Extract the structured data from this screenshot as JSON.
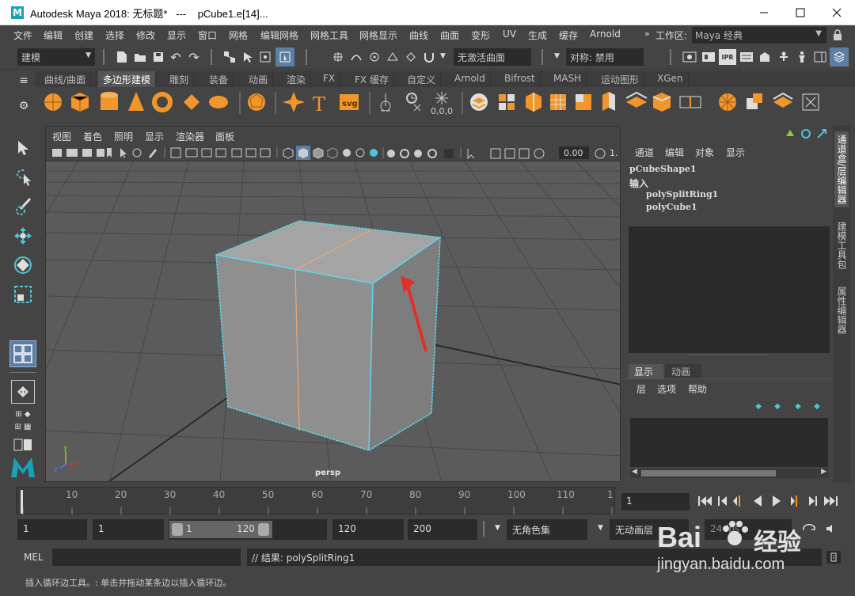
{
  "window": {
    "title": "Autodesk Maya 2018: 无标题*   ---    pCube1.e[14]...",
    "min_icon": "minimize-icon",
    "max_icon": "maximize-icon",
    "close_icon": "close-icon"
  },
  "menubar": {
    "items": [
      "文件",
      "编辑",
      "创建",
      "选择",
      "修改",
      "显示",
      "窗口",
      "网格",
      "编辑网格",
      "网格工具",
      "网格显示",
      "曲线",
      "曲面",
      "变形",
      "UV",
      "生成",
      "缓存",
      "Arnold"
    ],
    "workspace_label": "工作区:",
    "workspace_value": "Maya 经典"
  },
  "statusline": {
    "mode": "建模",
    "live_surface": "无激活曲面",
    "symmetry": "对称: 禁用"
  },
  "shelf": {
    "tabs": [
      "曲线/曲面",
      "多边形建模",
      "雕刻",
      "装备",
      "动画",
      "渲染",
      "FX",
      "FX 缓存",
      "自定义",
      "Arnold",
      "Bifrost",
      "MASH",
      "运动图形",
      "XGen"
    ],
    "active_tab": "多边形建模",
    "text_icon": "T",
    "svg_icon": "svg",
    "coord_label": "0,0,0"
  },
  "viewport": {
    "menu": [
      "视图",
      "着色",
      "照明",
      "显示",
      "渲染器",
      "面板"
    ],
    "exposure": "0.00",
    "gamma_partial": "1.",
    "camera_label": "persp",
    "axis_labels": {
      "y": "y",
      "x": "x",
      "z": "z"
    }
  },
  "channelbox": {
    "menu": [
      "通道",
      "编辑",
      "对象",
      "显示"
    ],
    "shape": "pCubeShape1",
    "inputs_label": "输入",
    "inputs": [
      "polySplitRing1",
      "polyCube1"
    ]
  },
  "layers": {
    "tabs": [
      "显示",
      "动画"
    ],
    "menu": [
      "层",
      "选项",
      "帮助"
    ]
  },
  "side_tabs": [
    "通道盒/层编辑器",
    "建模工具包",
    "属性编辑器"
  ],
  "timeline": {
    "ticks": [
      "10",
      "20",
      "30",
      "40",
      "50",
      "60",
      "70",
      "80",
      "90",
      "100",
      "110",
      "1"
    ],
    "current_frame": "1"
  },
  "range": {
    "start": "1",
    "playback_start": "1",
    "slider_start": "1",
    "slider_end": "120",
    "playback_end": "120",
    "end": "200",
    "character_set": "无角色集",
    "anim_layer": "无动画层",
    "fps_partial": "24 fps"
  },
  "command": {
    "lang": "MEL",
    "result": "// 结果: polySplitRing1"
  },
  "help": {
    "text": "插入循环边工具。: 单击并拖动某条边以插入循环边。"
  },
  "watermark": {
    "brand": "Bai",
    "brand2": "经验",
    "url": "jingyan.baidu.com"
  },
  "colors": {
    "accent": "#4fc3d8",
    "orange": "#f0962a",
    "viewport_bg": "#5b5b5b",
    "arrow": "#e0302a"
  }
}
